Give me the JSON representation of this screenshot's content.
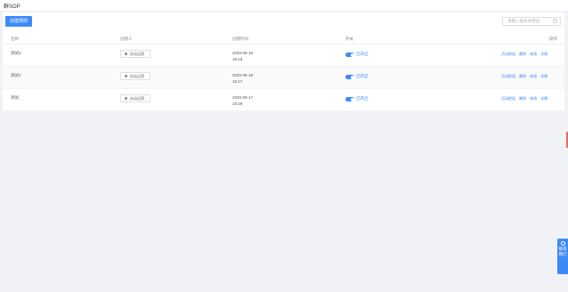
{
  "header": {
    "title": "群SOP"
  },
  "toolbar": {
    "create_label": "创建规则",
    "search_placeholder": "请输入搜索关键词"
  },
  "table": {
    "headers": [
      "名称",
      "创建人",
      "创建时间",
      "开关",
      "操作"
    ],
    "rows": [
      {
        "name": "测试3",
        "creator": "启动运营",
        "date": "2020-09-18",
        "time": "15:18",
        "switch": "已开启",
        "actions": [
          "活动群组",
          "删除",
          "修改",
          "详情"
        ]
      },
      {
        "name": "测试2",
        "creator": "启动运营",
        "date": "2020-09-18",
        "time": "15:17",
        "switch": "已开启",
        "actions": [
          "活动群组",
          "删除",
          "修改",
          "详情"
        ]
      },
      {
        "name": "测试",
        "creator": "启动运营",
        "date": "2020-09-17",
        "time": "16:29",
        "switch": "已开启",
        "actions": [
          "活动群组",
          "删除",
          "修改",
          "详情"
        ]
      }
    ]
  },
  "side_tab": {
    "label": "联系我们"
  },
  "colors": {
    "accent": "#3d8af7",
    "background": "#f0f2f5"
  }
}
